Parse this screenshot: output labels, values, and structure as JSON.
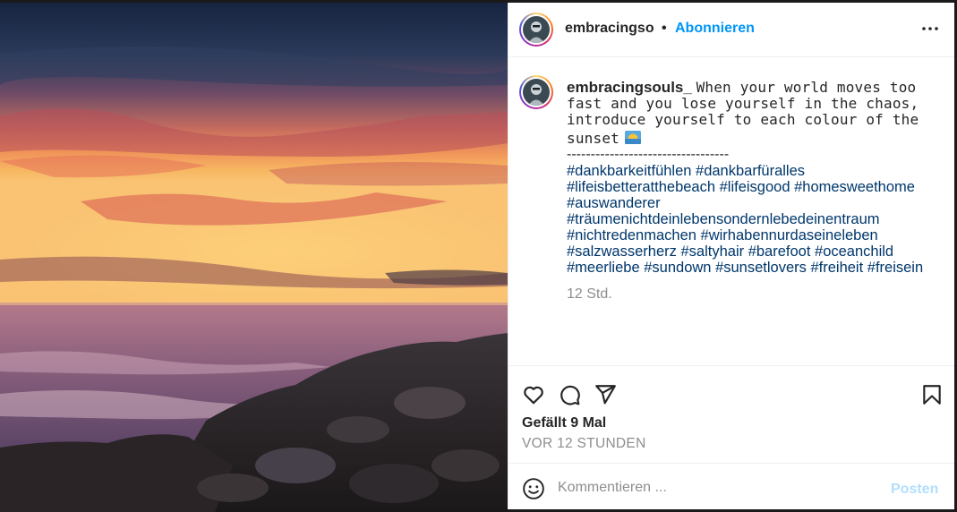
{
  "post": {
    "username_short": "embracingso",
    "dot": "•",
    "follow_label": "Abonnieren",
    "caption_username": "embracingsouls_",
    "caption_text": "When your world moves too fast and you lose yourself in the chaos, introduce yourself to each colour of the sunset",
    "divider": "----------------------------------",
    "hashtags": [
      "#dankbarkeitfühlen",
      "#dankbarfüralles",
      "#lifeisbetteratthebeach",
      "#lifeisgood",
      "#homesweethome",
      "#auswanderer",
      "#träumenichtdeinlebensondernlebedeinentraum",
      "#nichtredenmachen",
      "#wirhabennurdaseineleben",
      "#salzwasserherz",
      "#saltyhair",
      "#barefoot",
      "#oceanchild",
      "#meerliebe",
      "#sundown",
      "#sunsetlovers",
      "#freiheit",
      "#freisein"
    ],
    "caption_time": "12 Std.",
    "likes": "Gefällt 9 Mal",
    "post_time": "VOR 12 STUNDEN"
  },
  "comment": {
    "placeholder": "Kommentieren ...",
    "post_label": "Posten"
  },
  "colors": {
    "link_blue": "#0095f6",
    "hashtag": "#00376b",
    "muted": "#8e8e8e",
    "post_disabled": "#b2dffc"
  },
  "icons": [
    "more-options-icon",
    "heart-icon",
    "comment-icon",
    "share-icon",
    "bookmark-icon",
    "emoji-icon",
    "sunset-emoji-icon"
  ]
}
